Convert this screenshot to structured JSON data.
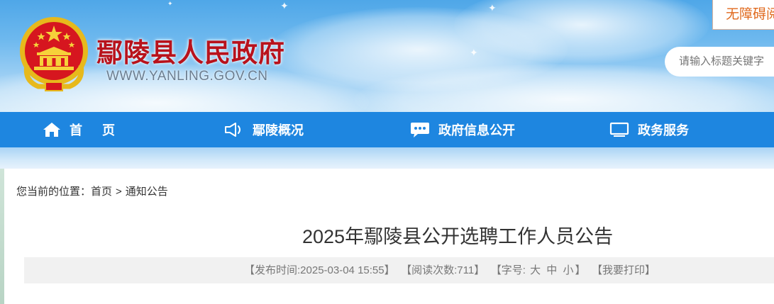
{
  "header": {
    "site_title": "鄢陵县人民政府",
    "site_url": "WWW.YANLING.GOV.CN",
    "accessibility_label": "无障碍阅读",
    "search": {
      "placeholder": "请输入标题关键字"
    }
  },
  "nav": {
    "items": [
      {
        "label": "首页",
        "icon": "home-icon"
      },
      {
        "label": "鄢陵概况",
        "icon": "megaphone-icon"
      },
      {
        "label": "政府信息公开",
        "icon": "chat-bubble-icon"
      },
      {
        "label": "政务服务",
        "icon": "monitor-icon"
      }
    ]
  },
  "breadcrumb": {
    "prefix": "您当前的位置：",
    "items": [
      "首页",
      "通知公告"
    ],
    "separator": ">"
  },
  "article": {
    "title": "2025年鄢陵县公开选聘工作人员公告",
    "publish_label": "【发布时间:",
    "publish_time": "2025-03-04 15:55",
    "publish_close": "】",
    "views_label": "【阅读次数:",
    "views": "711",
    "views_close": "】",
    "font_label": "【字号:",
    "font_sizes": [
      "大",
      "中",
      "小"
    ],
    "font_close": "】",
    "print_label": "【我要打印】"
  },
  "colors": {
    "nav_bg": "#1e86e0",
    "title_red": "#b8121c",
    "accessibility_orange": "#e06a1e"
  }
}
